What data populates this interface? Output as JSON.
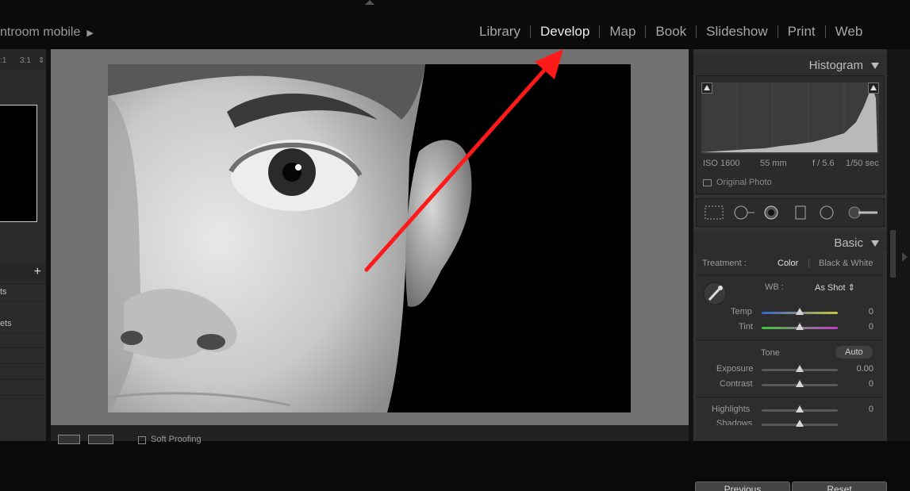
{
  "app": {
    "brand_text": "ntroom mobile",
    "brand_arrow": "▶"
  },
  "modules": [
    {
      "label": "Library",
      "active": false
    },
    {
      "label": "Develop",
      "active": true
    },
    {
      "label": "Map",
      "active": false
    },
    {
      "label": "Book",
      "active": false
    },
    {
      "label": "Slideshow",
      "active": false
    },
    {
      "label": "Print",
      "active": false
    },
    {
      "label": "Web",
      "active": false
    }
  ],
  "left_panel": {
    "zoom_a": ":1",
    "zoom_b": "3:1",
    "zoom_toggle": "⇕",
    "add": "+",
    "item1": "ts",
    "item2": "ets"
  },
  "histogram": {
    "title": "Histogram",
    "iso": "ISO 1600",
    "focal": "55 mm",
    "aperture": "f / 5.6",
    "shutter": "1/50 sec",
    "original_photo": "Original Photo"
  },
  "basic": {
    "title": "Basic",
    "treatment_label": "Treatment :",
    "treatment_color": "Color",
    "treatment_bw": "Black & White",
    "wb_label": "WB :",
    "wb_value": "As Shot",
    "wb_arrow": "⇕",
    "temp_label": "Temp",
    "temp_value": "0",
    "tint_label": "Tint",
    "tint_value": "0",
    "tone_label": "Tone",
    "auto_label": "Auto",
    "exposure_label": "Exposure",
    "exposure_value": "0.00",
    "contrast_label": "Contrast",
    "contrast_value": "0",
    "highlights_label": "Highlights",
    "highlights_value": "0",
    "shadows_label": "Shadows"
  },
  "toolbar": {
    "soft_proof_label": "Soft Proofing"
  },
  "bottom_buttons": {
    "previous": "Previous",
    "reset": "Reset"
  },
  "annotation": {
    "color": "#ff1a1a"
  },
  "colors": {
    "bg": "#0a0a0a",
    "panel": "#323232",
    "center": "#717171",
    "temp_gradient": [
      "#3a5fd0",
      "#c8c83a"
    ],
    "tint_gradient": [
      "#3ac83a",
      "#c83ac8"
    ]
  }
}
